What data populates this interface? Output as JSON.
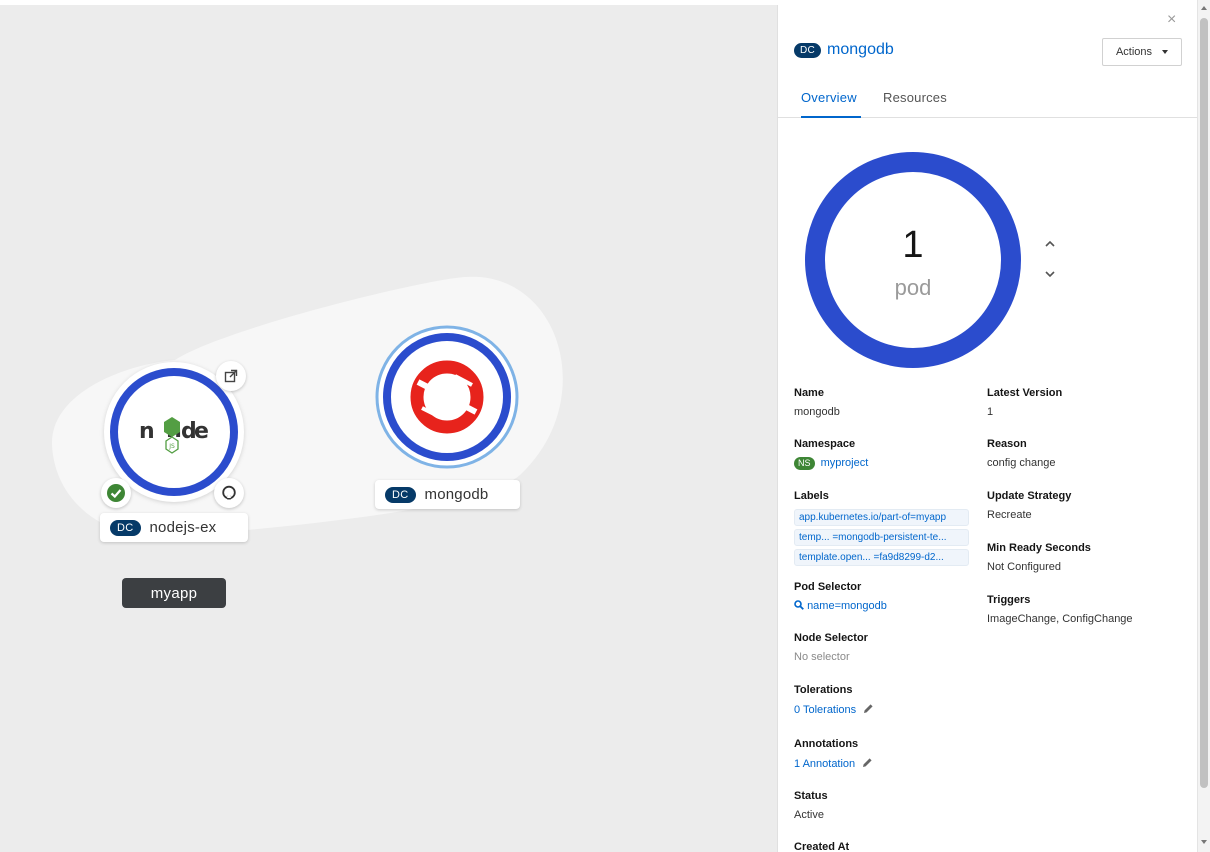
{
  "canvas": {
    "nodes": [
      {
        "badge": "DC",
        "name": "nodejs-ex"
      },
      {
        "badge": "DC",
        "name": "mongodb"
      }
    ],
    "group_label": "myapp",
    "colors": {
      "ring": "#2b4ccd",
      "accent": "#3e8635",
      "openshift_red": "#e7231c"
    }
  },
  "panel": {
    "close": "×",
    "badge": "DC",
    "title": "mongodb",
    "actions_label": "Actions",
    "tabs": [
      "Overview",
      "Resources"
    ],
    "pods": {
      "count": "1",
      "unit": "pod"
    },
    "left_column": {
      "name": {
        "label": "Name",
        "value": "mongodb"
      },
      "namespace": {
        "label": "Namespace",
        "badge": "NS",
        "value": "myproject"
      },
      "labels": {
        "label": "Labels",
        "items": [
          "app.kubernetes.io/part-of=myapp",
          "temp... =mongodb-persistent-te...",
          "template.open... =fa9d8299-d2..."
        ]
      },
      "pod_selector": {
        "label": "Pod Selector",
        "value": "name=mongodb"
      },
      "node_selector": {
        "label": "Node Selector",
        "value": "No selector"
      },
      "tolerations": {
        "label": "Tolerations",
        "value": "0 Tolerations"
      },
      "annotations": {
        "label": "Annotations",
        "value": "1 Annotation"
      },
      "status": {
        "label": "Status",
        "value": "Active"
      },
      "created_at": {
        "label": "Created At"
      }
    },
    "right_column": {
      "latest_version": {
        "label": "Latest Version",
        "value": "1"
      },
      "reason": {
        "label": "Reason",
        "value": "config change"
      },
      "update_strategy": {
        "label": "Update Strategy",
        "value": "Recreate"
      },
      "min_ready": {
        "label": "Min Ready Seconds",
        "value": "Not Configured"
      },
      "triggers": {
        "label": "Triggers",
        "value": "ImageChange, ConfigChange"
      }
    }
  }
}
